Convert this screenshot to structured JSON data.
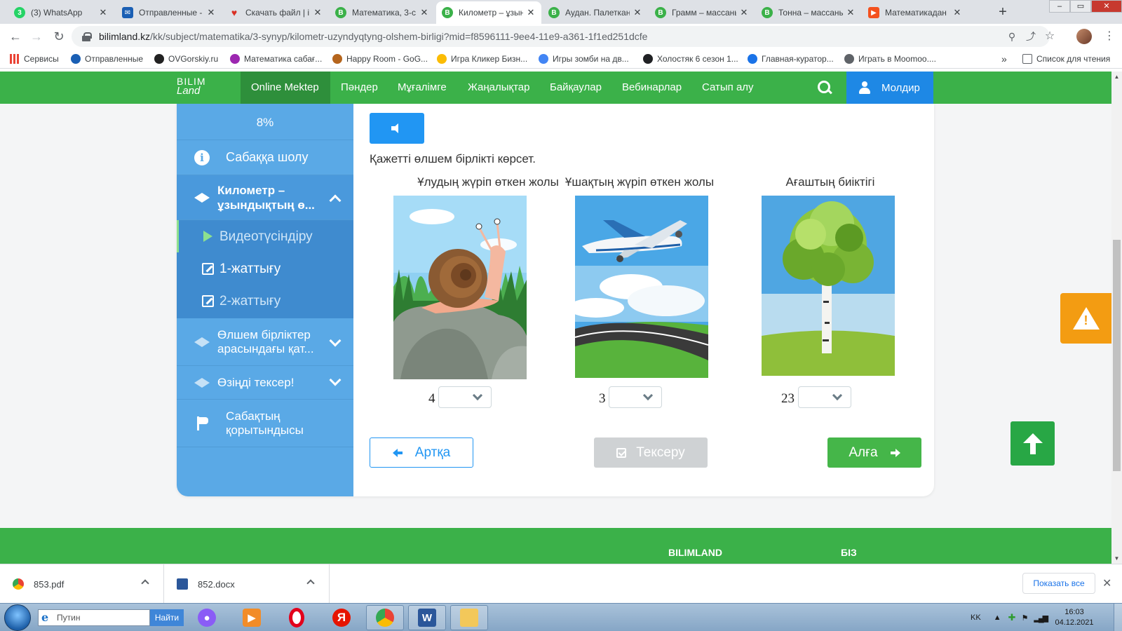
{
  "browser": {
    "tabs": [
      {
        "title": "(3) WhatsApp",
        "icon": "whatsapp-icon",
        "color": "#25d366",
        "badge": "3"
      },
      {
        "title": "Отправленные -",
        "icon": "mail-icon",
        "color": "#1a5fb4",
        "badge": "✉"
      },
      {
        "title": "Скачать файл | iL",
        "icon": "heart-icon",
        "color": "#d93025",
        "badge": "♥"
      },
      {
        "title": "Математика, 3-с",
        "icon": "bilimland-icon",
        "color": "#3bb149",
        "badge": "B"
      },
      {
        "title": "Километр – ұзын",
        "icon": "bilimland-icon",
        "color": "#3bb149",
        "badge": "B",
        "active": true
      },
      {
        "title": "Аудан. Палеткан",
        "icon": "bilimland-icon",
        "color": "#3bb149",
        "badge": "B"
      },
      {
        "title": "Грамм – массаны",
        "icon": "bilimland-icon",
        "color": "#3bb149",
        "badge": "B"
      },
      {
        "title": "Тонна – массаны",
        "icon": "bilimland-icon",
        "color": "#3bb149",
        "badge": "B"
      },
      {
        "title": "Математикадан",
        "icon": "slides-icon",
        "color": "#f4511e",
        "badge": "▶"
      }
    ],
    "close_glyph": "✕",
    "new_tab_glyph": "+",
    "window_controls": {
      "minimize": "–",
      "restore": "▭",
      "close": "✕"
    },
    "url_host": "bilimland.kz",
    "url_path": "/kk/subject/matematika/3-synyp/kilometr-uzyndyqtyng-olshem-birligi?mid=f8596111-9ee4-11e9-a361-1f1ed251dcfe",
    "bookmarks": [
      {
        "label": "Сервисы",
        "icon": "apps-grid-icon",
        "color": "#ea4335"
      },
      {
        "label": "Отправленные",
        "icon": "mail-icon",
        "color": "#1a5fb4"
      },
      {
        "label": "OVGorskiy.ru",
        "icon": "ovgorskiy-icon",
        "color": "#222222"
      },
      {
        "label": "Математика сабағ...",
        "icon": "site-icon",
        "color": "#9c27b0"
      },
      {
        "label": "Happy Room - GoG...",
        "icon": "game-icon",
        "color": "#b5651d"
      },
      {
        "label": "Игра Кликер Бизн...",
        "icon": "game-icon",
        "color": "#fbbc04"
      },
      {
        "label": "Игры зомби на дв...",
        "icon": "google-icon",
        "color": "#4285f4"
      },
      {
        "label": "Холостяк 6 сезон 1...",
        "icon": "kinopoisk-icon",
        "color": "#202124"
      },
      {
        "label": "Главная-куратор...",
        "icon": "site-icon",
        "color": "#1a73e8"
      },
      {
        "label": "Играть в Moomoo....",
        "icon": "globe-icon",
        "color": "#5f6368"
      }
    ],
    "bookmarks_overflow": "»",
    "reading_list": "Список для чтения"
  },
  "site": {
    "logo_line1": "BILIM",
    "logo_line2": "Land",
    "nav": [
      "Online Mektep",
      "Пәндер",
      "Мұғалімге",
      "Жаңалықтар",
      "Байқаулар",
      "Вебинарлар",
      "Сатып алу"
    ],
    "user_name": "Молдир",
    "brand_green": "#3bb149",
    "accent_blue": "#1e88e5"
  },
  "sidebar": {
    "progress": "8%",
    "progress_value": 8,
    "overview": "Сабаққа шолу",
    "current_topic": "Километр – ұзындықтың ө...",
    "sub_items": [
      "Видеотүсіндіру",
      "1-жаттығу",
      "2-жаттығу"
    ],
    "topic_2": "Өлшем бірліктер арасындағы қат...",
    "topic_3": "Өзіңді тексер!",
    "summary": "Сабақтың қорытындысы"
  },
  "exercise": {
    "instruction": "Қажетті өлшем бірлікті көрсет.",
    "items": [
      {
        "title": "Ұлудың жүріп өткен жолы",
        "number": "4",
        "image": "snail-on-rock",
        "selected": ""
      },
      {
        "title": "Ұшақтың жүріп өткен жолы",
        "number": "3",
        "image": "airplane-over-road",
        "selected": ""
      },
      {
        "title": "Ағаштың биіктігі",
        "number": "23",
        "image": "birch-tree",
        "selected": ""
      }
    ],
    "back_label": "Артқа",
    "check_label": "Тексеру",
    "next_label": "Алға"
  },
  "footer": {
    "links": [
      "BILIMLAND",
      "БІЗ"
    ]
  },
  "downloads": {
    "files": [
      {
        "name": "853.pdf",
        "icon": "chrome-file-icon"
      },
      {
        "name": "852.docx",
        "icon": "word-file-icon"
      }
    ],
    "show_all": "Показать все",
    "close_glyph": "✕"
  },
  "taskbar": {
    "search_placeholder": "Путин",
    "find_button": "Найти",
    "apps": [
      "alice-icon",
      "media-player-icon",
      "opera-icon",
      "yandex-icon",
      "chrome-icon",
      "word-icon",
      "explorer-icon"
    ],
    "lang": "KK",
    "time": "16:03",
    "date": "04.12.2021"
  }
}
